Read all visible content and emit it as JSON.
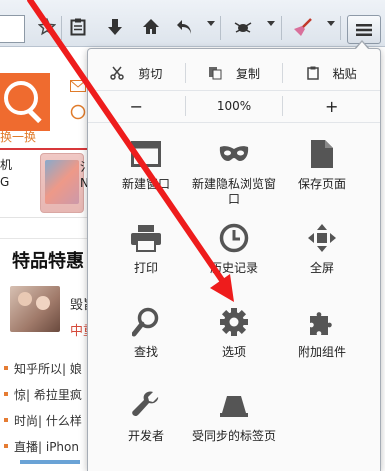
{
  "toolbar": {
    "icons": [
      "star-icon",
      "clipboard-icon",
      "download-icon",
      "home-icon",
      "back-icon",
      "bug-icon",
      "broom-icon",
      "menu-icon"
    ]
  },
  "page_behind": {
    "orange_link": "换一换",
    "product_line1": "机",
    "product_line2": "G",
    "product_side": "氵",
    "product_side2": "N",
    "section_title": "特品特惠",
    "item_title": "毁旨",
    "item_subtitle": "中重",
    "news": [
      "知乎所以| 娘",
      "惊| 希拉里疯",
      "时尚| 什么样",
      "直播| iPhon"
    ]
  },
  "menu": {
    "edit_row": {
      "cut": "剪切",
      "copy": "复制",
      "paste": "粘贴"
    },
    "zoom_row": {
      "minus": "−",
      "level": "100%",
      "plus": "+"
    },
    "tiles": [
      {
        "icon": "window-icon",
        "label": "新建窗口"
      },
      {
        "icon": "mask-icon",
        "label": "新建隐私浏览窗口"
      },
      {
        "icon": "page-icon",
        "label": "保存页面"
      },
      {
        "icon": "printer-icon",
        "label": "打印"
      },
      {
        "icon": "clock-icon",
        "label": "历史记录"
      },
      {
        "icon": "fullscreen-icon",
        "label": "全屏"
      },
      {
        "icon": "search-icon",
        "label": "查找"
      },
      {
        "icon": "gear-icon",
        "label": "选项"
      },
      {
        "icon": "puzzle-icon",
        "label": "附加组件"
      },
      {
        "icon": "wrench-icon",
        "label": "开发者"
      },
      {
        "icon": "synced-tabs-icon",
        "label": "受同步的标签页"
      }
    ]
  },
  "colors": {
    "annotation_arrow": "#ee1c1c",
    "accent_orange": "#ef6b2f",
    "icon_gray": "#555555"
  }
}
